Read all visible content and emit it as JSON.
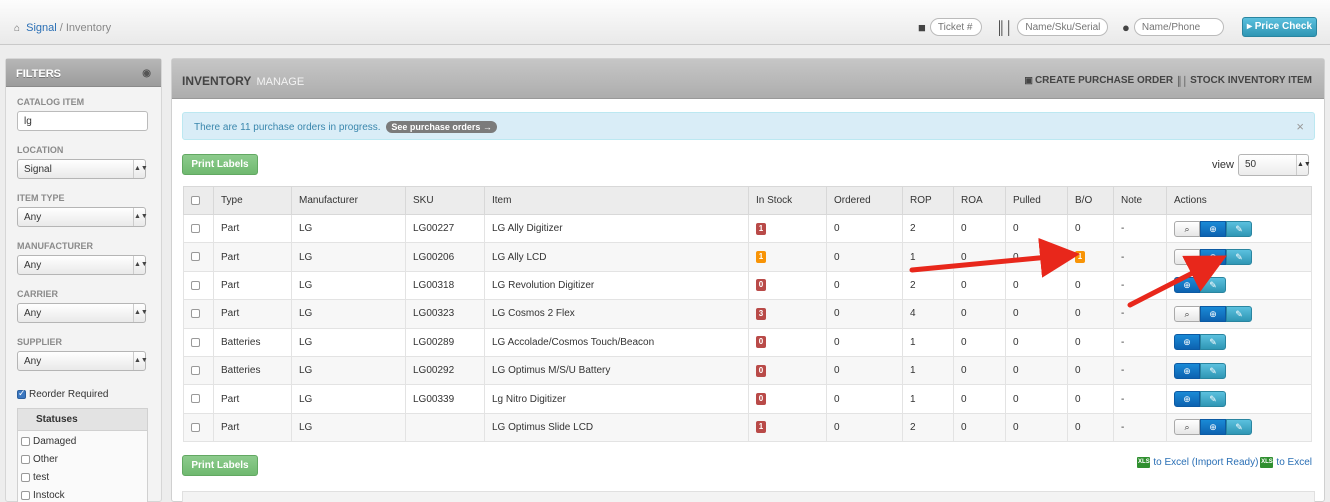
{
  "breadcrumb": {
    "home": "Signal",
    "sep": "/",
    "current": "Inventory"
  },
  "top_search": {
    "ticket_placeholder": "Ticket #",
    "sku_placeholder": "Name/Sku/Serial",
    "customer_placeholder": "Name/Phone",
    "price_check_label": "Price Check"
  },
  "filters": {
    "title": "FILTERS",
    "catalog_item_label": "CATALOG ITEM",
    "catalog_item_value": "lg",
    "location_label": "LOCATION",
    "location_value": "Signal",
    "item_type_label": "ITEM TYPE",
    "item_type_value": "Any",
    "manufacturer_label": "MANUFACTURER",
    "manufacturer_value": "Any",
    "carrier_label": "CARRIER",
    "carrier_value": "Any",
    "supplier_label": "SUPPLIER",
    "supplier_value": "Any",
    "reorder_label": "Reorder Required",
    "reorder_checked": true,
    "statuses_title": "Statuses",
    "statuses": [
      "Damaged",
      "Other",
      "test",
      "Instock"
    ]
  },
  "main": {
    "title": "INVENTORY",
    "subtitle": "MANAGE",
    "create_po_label": "CREATE PURCHASE ORDER",
    "stock_item_label": "STOCK INVENTORY ITEM",
    "alert_text": "There are 11 purchase orders in progress.",
    "alert_link": "See purchase orders →",
    "print_labels": "Print Labels",
    "view_label": "view",
    "view_value": "50",
    "export_ready": "to Excel (Import Ready)",
    "export": "to Excel"
  },
  "table": {
    "columns": [
      "Type",
      "Manufacturer",
      "SKU",
      "Item",
      "In Stock",
      "Ordered",
      "ROP",
      "ROA",
      "Pulled",
      "B/O",
      "Note",
      "Actions"
    ],
    "rows": [
      {
        "type": "Part",
        "manufacturer": "LG",
        "sku": "LG00227",
        "item": "LG Ally Digitizer",
        "in_stock": "1",
        "stock_color": "red",
        "ordered": "0",
        "rop": "2",
        "roa": "0",
        "pulled": "0",
        "bo": "0",
        "bo_badge": false,
        "note": "-",
        "actions": "full"
      },
      {
        "type": "Part",
        "manufacturer": "LG",
        "sku": "LG00206",
        "item": "LG Ally LCD",
        "in_stock": "1",
        "stock_color": "orange",
        "ordered": "0",
        "rop": "1",
        "roa": "0",
        "pulled": "0",
        "bo": "1",
        "bo_badge": true,
        "note": "-",
        "actions": "full"
      },
      {
        "type": "Part",
        "manufacturer": "LG",
        "sku": "LG00318",
        "item": "LG Revolution Digitizer",
        "in_stock": "0",
        "stock_color": "red",
        "ordered": "0",
        "rop": "2",
        "roa": "0",
        "pulled": "0",
        "bo": "0",
        "bo_badge": false,
        "note": "-",
        "actions": "short"
      },
      {
        "type": "Part",
        "manufacturer": "LG",
        "sku": "LG00323",
        "item": "LG Cosmos 2 Flex",
        "in_stock": "3",
        "stock_color": "red",
        "ordered": "0",
        "rop": "4",
        "roa": "0",
        "pulled": "0",
        "bo": "0",
        "bo_badge": false,
        "note": "-",
        "actions": "full"
      },
      {
        "type": "Batteries",
        "manufacturer": "LG",
        "sku": "LG00289",
        "item": "LG Accolade/Cosmos Touch/Beacon",
        "in_stock": "0",
        "stock_color": "red",
        "ordered": "0",
        "rop": "1",
        "roa": "0",
        "pulled": "0",
        "bo": "0",
        "bo_badge": false,
        "note": "-",
        "actions": "short"
      },
      {
        "type": "Batteries",
        "manufacturer": "LG",
        "sku": "LG00292",
        "item": "LG Optimus M/S/U Battery",
        "in_stock": "0",
        "stock_color": "red",
        "ordered": "0",
        "rop": "1",
        "roa": "0",
        "pulled": "0",
        "bo": "0",
        "bo_badge": false,
        "note": "-",
        "actions": "short"
      },
      {
        "type": "Part",
        "manufacturer": "LG",
        "sku": "LG00339",
        "item": "Lg Nitro Digitizer",
        "in_stock": "0",
        "stock_color": "red",
        "ordered": "0",
        "rop": "1",
        "roa": "0",
        "pulled": "0",
        "bo": "0",
        "bo_badge": false,
        "note": "-",
        "actions": "short"
      },
      {
        "type": "Part",
        "manufacturer": "LG",
        "sku": "",
        "item": "LG Optimus Slide LCD",
        "in_stock": "1",
        "stock_color": "red",
        "ordered": "0",
        "rop": "2",
        "roa": "0",
        "pulled": "0",
        "bo": "0",
        "bo_badge": false,
        "note": "-",
        "actions": "full"
      }
    ]
  },
  "colors": {
    "accent": "#2a6fb5",
    "danger": "#b94a48",
    "warning": "#f89406",
    "success": "#6fb96f",
    "info": "#5bc0de",
    "arrow": "#e8271b"
  },
  "icons": {
    "home": "home-icon",
    "ticket": "bookmark-icon",
    "barcode": "barcode-icon",
    "user": "user-icon",
    "view": "magnifier-icon",
    "add": "plus-circle-icon",
    "edit": "pencil-icon"
  }
}
